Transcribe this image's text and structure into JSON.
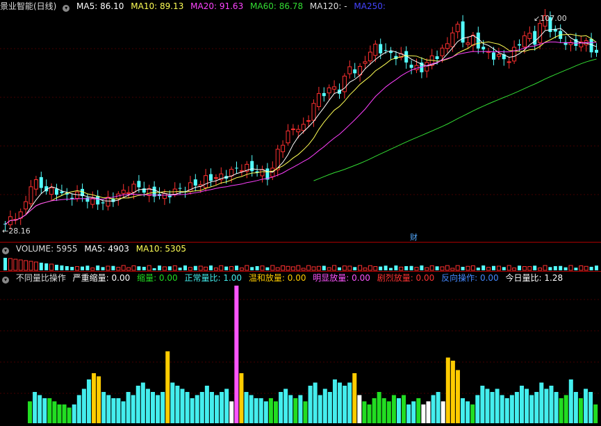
{
  "main": {
    "title": "景业智能(日线)",
    "ma5": "MA5: 86.10",
    "ma10": "MA10: 89.13",
    "ma20": "MA20: 91.63",
    "ma60": "MA60: 86.78",
    "ma120": "MA120: -",
    "ma250": "MA250:",
    "high_label": "107.00",
    "low_label": "28.16",
    "finance_marker": "财"
  },
  "volume": {
    "title": "VOLUME: 5955",
    "ma5": "MA5: 4903",
    "ma10": "MA10: 5305"
  },
  "indicator": {
    "title": "不同量比操作",
    "severe_shrink": "严重缩量: 0.00",
    "shrink": "缩量: 0.00",
    "normal": "正常量比: 1.00",
    "mild": "温和放量: 0.00",
    "obvious": "明显放量: 0.00",
    "sharp": "剧烈放量: 0.00",
    "reverse": "反向操作: 0.00",
    "today": "今日量比: 1.28"
  },
  "colors": {
    "up": "#ff3030",
    "down": "#54ffff",
    "ma5": "#ffffff",
    "ma10": "#ffff55",
    "ma20": "#ff40ff",
    "ma60": "#33dd33",
    "ma250": "#4444ff",
    "bar_green": "#22dd22",
    "bar_cyan": "#44eeee",
    "bar_orange": "#ffcc00",
    "bar_magenta": "#ff55ff",
    "bar_white": "#ffffff"
  },
  "chart_data": [
    {
      "type": "candlestick",
      "title": "景业智能(日线)",
      "ylim": [
        28.16,
        107.0
      ],
      "annotations": [
        "107.00",
        "28.16",
        "财"
      ],
      "series": [
        {
          "name": "price",
          "close_trend": [
            30,
            33,
            34,
            46,
            44,
            42,
            42,
            40,
            41,
            40,
            38,
            38,
            39,
            41,
            43,
            44,
            42,
            41,
            40,
            42,
            43,
            44,
            45,
            47,
            47,
            48,
            50,
            51,
            50,
            49,
            47,
            58,
            63,
            66,
            65,
            75,
            78,
            80,
            79,
            88,
            85,
            92,
            95,
            93,
            92,
            91,
            88,
            86,
            90,
            92,
            95,
            104,
            96,
            98,
            94,
            92,
            91,
            90,
            95,
            100,
            97,
            107,
            100,
            98,
            95,
            97,
            96,
            92
          ]
        }
      ]
    },
    {
      "type": "bar",
      "title": "VOLUME: 5955",
      "series": [
        {
          "name": "VOLUME",
          "values": [
            5955
          ]
        },
        {
          "name": "MA5",
          "values": [
            4903
          ]
        },
        {
          "name": "MA10",
          "values": [
            5305
          ]
        }
      ]
    },
    {
      "type": "bar",
      "title": "不同量比操作",
      "values": [
        0.7,
        1.0,
        0.9,
        0.8,
        0.8,
        0.7,
        0.6,
        0.6,
        0.5,
        0.6,
        0.9,
        1.1,
        1.4,
        1.6,
        1.5,
        1.0,
        0.9,
        0.8,
        0.8,
        0.7,
        1.0,
        0.9,
        1.2,
        1.3,
        1.1,
        1.0,
        0.9,
        1.0,
        2.3,
        1.3,
        1.2,
        1.1,
        1.0,
        0.8,
        0.9,
        1.0,
        1.2,
        1.0,
        0.9,
        1.0,
        1.1,
        0.7,
        4.4,
        1.6,
        1.0,
        0.9,
        0.8,
        0.8,
        0.7,
        0.8,
        0.7,
        1.0,
        1.1,
        0.9,
        0.8,
        0.9,
        0.7,
        1.2,
        1.3,
        0.9,
        1.1,
        1.0,
        1.4,
        1.3,
        1.2,
        1.3,
        1.6,
        0.9,
        0.7,
        0.6,
        0.8,
        1.0,
        0.8,
        0.7,
        0.9,
        0.8,
        0.9,
        0.6,
        0.7,
        0.8,
        0.6,
        0.7,
        0.9,
        1.0,
        0.7,
        2.1,
        2.0,
        1.7,
        0.8,
        0.7,
        0.6,
        0.9,
        1.2,
        1.1,
        1.0,
        1.1,
        0.9,
        0.8,
        0.9,
        1.0,
        1.2,
        1.1,
        0.9,
        1.0,
        1.3,
        1.1,
        1.2,
        1.0,
        0.8,
        0.9,
        1.4,
        1.0,
        0.8,
        1.1,
        1.0,
        0.6
      ],
      "colors_key": [
        "g",
        "c",
        "c",
        "c",
        "g",
        "g",
        "g",
        "g",
        "g",
        "c",
        "c",
        "c",
        "c",
        "o",
        "o",
        "c",
        "c",
        "c",
        "c",
        "c",
        "c",
        "c",
        "c",
        "c",
        "c",
        "c",
        "c",
        "c",
        "o",
        "c",
        "c",
        "c",
        "c",
        "c",
        "c",
        "c",
        "c",
        "c",
        "c",
        "c",
        "c",
        "w",
        "m",
        "o",
        "c",
        "c",
        "c",
        "c",
        "c",
        "g",
        "g",
        "c",
        "c",
        "c",
        "g",
        "c",
        "g",
        "c",
        "c",
        "c",
        "c",
        "c",
        "c",
        "c",
        "c",
        "c",
        "o",
        "w",
        "g",
        "g",
        "g",
        "g",
        "g",
        "g",
        "g",
        "c",
        "g",
        "c",
        "c",
        "g",
        "w",
        "w",
        "c",
        "c",
        "w",
        "o",
        "o",
        "o",
        "c",
        "c",
        "g",
        "c",
        "c",
        "c",
        "c",
        "c",
        "c",
        "c",
        "c",
        "c",
        "c",
        "c",
        "c",
        "c",
        "c",
        "c",
        "c",
        "c",
        "g",
        "g",
        "c",
        "c",
        "g",
        "c",
        "c",
        "g"
      ]
    }
  ]
}
